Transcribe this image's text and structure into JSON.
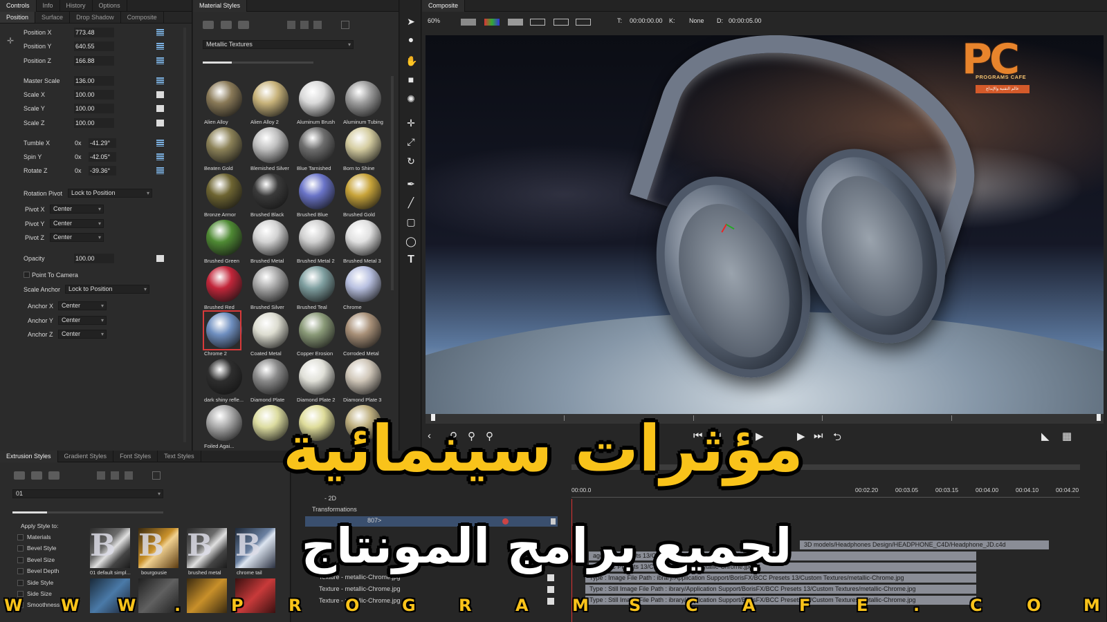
{
  "controls": {
    "tabs": [
      "Controls",
      "Info",
      "History",
      "Options"
    ],
    "subtabs": [
      "Position",
      "Surface",
      "Drop Shadow",
      "Composite"
    ],
    "params": [
      {
        "label": "Position X",
        "value": "773.48"
      },
      {
        "label": "Position Y",
        "value": "640.55"
      },
      {
        "label": "Position Z",
        "value": "166.88"
      },
      {
        "label": "Master Scale",
        "value": "136.00"
      },
      {
        "label": "Scale X",
        "value": "100.00"
      },
      {
        "label": "Scale Y",
        "value": "100.00"
      },
      {
        "label": "Scale Z",
        "value": "100.00"
      }
    ],
    "rotations": [
      {
        "label": "Tumble X",
        "mult": "0x",
        "value": "-41.29°"
      },
      {
        "label": "Spin Y",
        "mult": "0x",
        "value": "-42.05°"
      },
      {
        "label": "Rotate Z",
        "mult": "0x",
        "value": "-39.36°"
      }
    ],
    "rotation_pivot": {
      "label": "Rotation Pivot",
      "value": "Lock to Position"
    },
    "pivots": [
      {
        "label": "Pivot X",
        "value": "Center"
      },
      {
        "label": "Pivot Y",
        "value": "Center"
      },
      {
        "label": "Pivot Z",
        "value": "Center"
      }
    ],
    "opacity": {
      "label": "Opacity",
      "value": "100.00"
    },
    "point_to_camera": "Point To Camera",
    "scale_anchor": {
      "label": "Scale Anchor",
      "value": "Lock to Position"
    },
    "anchors": [
      {
        "label": "Anchor X",
        "value": "Center"
      },
      {
        "label": "Anchor Y",
        "value": "Center"
      },
      {
        "label": "Anchor Z",
        "value": "Center"
      }
    ]
  },
  "materials": {
    "title": "Material Styles",
    "category": "Metallic Textures",
    "tiles": [
      {
        "label": "Alien Alloy",
        "color": "#8a7a58"
      },
      {
        "label": "Alien Alloy 2",
        "color": "#c7b27a"
      },
      {
        "label": "Aluminum Brush",
        "color": "#d9d9d9"
      },
      {
        "label": "Aluminum Tubing",
        "color": "#9c9c9c"
      },
      {
        "label": "Beaten Gold",
        "color": "#8c8258"
      },
      {
        "label": "Blemished Silver",
        "color": "#bfbfbf"
      },
      {
        "label": "Blue Tarnished",
        "color": "#6e6e6e"
      },
      {
        "label": "Born to Shine",
        "color": "#d4cca0"
      },
      {
        "label": "Bronze Armor",
        "color": "#6e6532"
      },
      {
        "label": "Brushed Black",
        "color": "#3a3a3a"
      },
      {
        "label": "Brushed Blue",
        "color": "#6a74c8"
      },
      {
        "label": "Brushed Gold",
        "color": "#c8a43a"
      },
      {
        "label": "Brushed Green",
        "color": "#4f8a34"
      },
      {
        "label": "Brushed Metal",
        "color": "#d2d2d2"
      },
      {
        "label": "Brushed Metal 2",
        "color": "#cfcfcf"
      },
      {
        "label": "Brushed Metal 3",
        "color": "#e0e0e0"
      },
      {
        "label": "Brushed Red",
        "color": "#c2263a"
      },
      {
        "label": "Brushed Silver",
        "color": "#a8a8a8"
      },
      {
        "label": "Brushed Teal",
        "color": "#7f9fa0"
      },
      {
        "label": "Chrome",
        "color": "#b8c0e0"
      },
      {
        "label": "Chrome 2",
        "color": "#6f8fc0"
      },
      {
        "label": "Coated Metal",
        "color": "#dcdcd0"
      },
      {
        "label": "Copper Erosion",
        "color": "#8a9a78"
      },
      {
        "label": "Corroded Metal",
        "color": "#a89078"
      },
      {
        "label": "dark shiny refle...",
        "color": "#2e2e2e"
      },
      {
        "label": "Diamond Plate",
        "color": "#8a8a8a"
      },
      {
        "label": "Diamond Plate 2",
        "color": "#e0e0d8"
      },
      {
        "label": "Diamond Plate 3",
        "color": "#cfc6b8"
      },
      {
        "label": "Foiled Agai...",
        "color": "#aaaaaa"
      },
      {
        "label": "",
        "color": "#dcdca0"
      },
      {
        "label": "",
        "color": "#dedc9a"
      },
      {
        "label": "",
        "color": "#bfb080"
      }
    ],
    "selected_index": 20
  },
  "composite": {
    "title": "Composite",
    "zoom": "60%",
    "t_label": "T:",
    "t_value": "00:00:00.00",
    "k_label": "K:",
    "k_value": "None",
    "d_label": "D:",
    "d_value": "00:00:05.00",
    "logo_letters": "PC",
    "logo_name": "PROGRAMS CAFE",
    "logo_tag": "عالم التقنية والإبداع"
  },
  "extrusion": {
    "tabs": [
      "Extrusion Styles",
      "Gradient Styles",
      "Font Styles",
      "Text Styles"
    ],
    "preset": "01",
    "apply_label": "Apply Style to:",
    "apply_items": [
      "Materials",
      "Bevel Style",
      "Bevel Size",
      "Bevel Depth",
      "Side Style",
      "Side Size",
      "Smoothness"
    ],
    "thumbs": [
      "01 default simpl...",
      "bourgousie",
      "brushed metal",
      "chrome tail"
    ]
  },
  "timeline": {
    "rows": [
      "- 2D",
      "Transformations",
      "807>"
    ],
    "ruler": [
      "00:00.0",
      "00:02.20",
      "00:03.05",
      "00:03.15",
      "00:04.00",
      "00:04.10",
      "00:04.20"
    ],
    "textures": [
      "Texture - metallic-Chrome.jpg",
      "Texture - metallic-Chrome.jpg",
      "Texture - metallic-Chrome.jpg"
    ],
    "paths": [
      "3D models/Headphones Design/HEADPHONE_C4D/Headphone_JD.c4d",
      "age     BCC Presets 13/Custom Textures/metallic-Chrome.jpg",
      "FX/BCC Presets 13/Custom Textures/metallic-Chrome.jpg",
      "Type :  Image File       Path :  ibrary/Application Support/BorisFX/BCC Presets 13/Custom Textures/metallic-Chrome.jpg",
      "Type :  Still Image File       Path :  ibrary/Application Support/BorisFX/BCC Presets 13/Custom Textures/metallic-Chrome.jpg",
      "Type :  Still Image File       Path :  ibrary/Application Support/BorisFX/BCC Presets 13/Custom Textures/metallic-Chrome.jpg"
    ]
  },
  "overlay": {
    "title": "مؤثرات سينمائية",
    "subtitle": "لجميع برامج المونتاج",
    "watermark": [
      "W",
      "W",
      "W",
      ".",
      "P",
      "R",
      "O",
      "G",
      "R",
      "A",
      "M",
      "S",
      "C",
      "A",
      "F",
      "E",
      ".",
      "C",
      "O",
      "M"
    ]
  }
}
